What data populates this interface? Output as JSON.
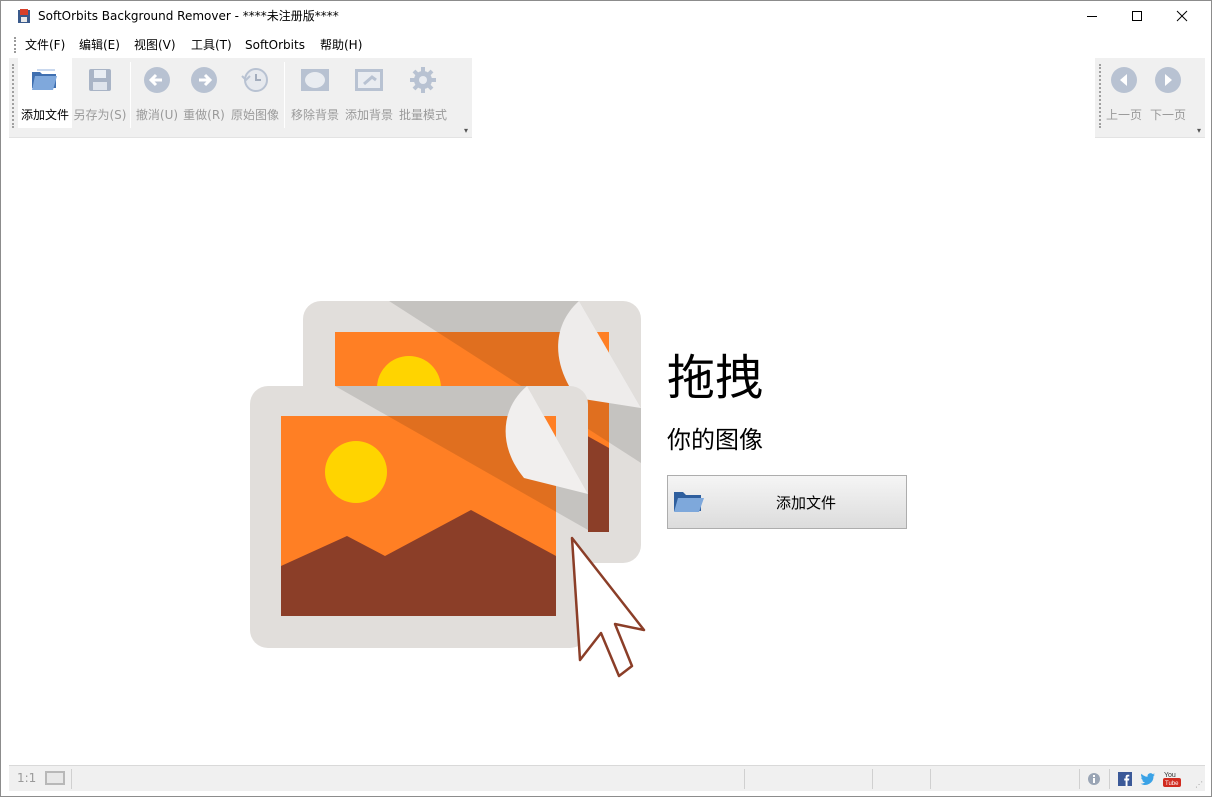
{
  "window": {
    "title": "SoftOrbits Background Remover - ****未注册版****"
  },
  "menu": {
    "items": [
      {
        "label": "文件(F)"
      },
      {
        "label": "编辑(E)"
      },
      {
        "label": "视图(V)"
      },
      {
        "label": "工具(T)"
      },
      {
        "label": "SoftOrbits"
      },
      {
        "label": "帮助(H)"
      }
    ]
  },
  "toolbar": {
    "buttons": [
      {
        "label": "添加文件",
        "icon": "open-folder-icon",
        "enabled": true
      },
      {
        "label": "另存为(S)",
        "icon": "floppy-disk-icon",
        "enabled": false
      },
      {
        "label": "撤消(U)",
        "icon": "undo-arrow-icon",
        "enabled": false
      },
      {
        "label": "重做(R)",
        "icon": "redo-arrow-icon",
        "enabled": false
      },
      {
        "label": "原始图像",
        "icon": "history-clock-icon",
        "enabled": false
      },
      {
        "label": "移除背景",
        "icon": "remove-background-icon",
        "enabled": false
      },
      {
        "label": "添加背景",
        "icon": "add-background-icon",
        "enabled": false
      },
      {
        "label": "批量模式",
        "icon": "gear-icon",
        "enabled": false
      }
    ],
    "nav_buttons": [
      {
        "label": "上一页",
        "icon": "previous-page-icon",
        "enabled": false
      },
      {
        "label": "下一页",
        "icon": "next-page-icon",
        "enabled": false
      }
    ]
  },
  "main": {
    "drag_title": "拖拽",
    "drag_subtitle": "你的图像",
    "add_file_button": "添加文件"
  },
  "statusbar": {
    "zoom": "1:1"
  },
  "colors": {
    "accent_orange": "#ff7f24",
    "mountain_brown": "#8b3e28",
    "sun_yellow": "#ffd400",
    "frame_gray": "#e1dedb",
    "disabled_text": "#9a9a9a"
  }
}
